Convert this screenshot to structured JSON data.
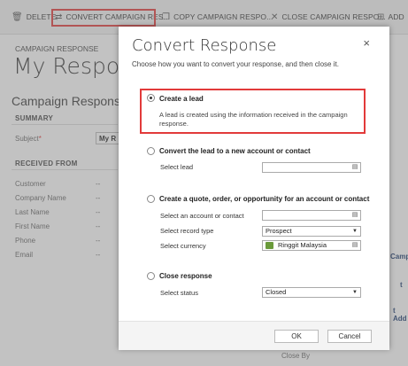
{
  "toolbar": {
    "delete_label": "DELETE",
    "convert_label": "CONVERT CAMPAIGN RES...",
    "copy_label": "COPY CAMPAIGN RESPO...",
    "close_label": "CLOSE CAMPAIGN RESPO...",
    "add_label": "ADD"
  },
  "page": {
    "entity_label": "CAMPAIGN RESPONSE",
    "title": "My Respons",
    "section_title": "Campaign Respons",
    "summary_head": "SUMMARY",
    "subject_label": "Subject",
    "subject_value": "My R",
    "received_head": "RECEIVED FROM",
    "fields": [
      {
        "label": "Customer",
        "value": "--"
      },
      {
        "label": "Company Name",
        "value": "--"
      },
      {
        "label": "Last Name",
        "value": "--"
      },
      {
        "label": "First Name",
        "value": "--"
      },
      {
        "label": "Phone",
        "value": "--"
      },
      {
        "label": "Email",
        "value": "--"
      }
    ],
    "right_camp": "Camp",
    "right_t": "t",
    "right_add": "t Add",
    "right_closeby": "Close By"
  },
  "dialog": {
    "title": "Convert Response",
    "subtitle": "Choose how you want to convert your response, and then close it.",
    "close_glyph": "×",
    "opt_lead_label": "Create a lead",
    "opt_lead_desc": "A lead is created using the information received in the campaign response.",
    "opt_convert_label": "Convert the lead to a new account or contact",
    "select_lead_label": "Select lead",
    "opt_quote_label": "Create a quote, order, or opportunity for an account or contact",
    "select_account_label": "Select an account or contact",
    "select_record_type_label": "Select record type",
    "record_type_value": "Prospect",
    "select_currency_label": "Select currency",
    "currency_value": "Ringgit Malaysia",
    "opt_close_label": "Close response",
    "select_status_label": "Select status",
    "status_value": "Closed",
    "ok_label": "OK",
    "cancel_label": "Cancel"
  },
  "colors": {
    "highlight": "#e23a3a"
  },
  "icons": {
    "lookup": "lookup-icon",
    "dropdown": "chevron-down-icon",
    "close": "close-icon"
  }
}
